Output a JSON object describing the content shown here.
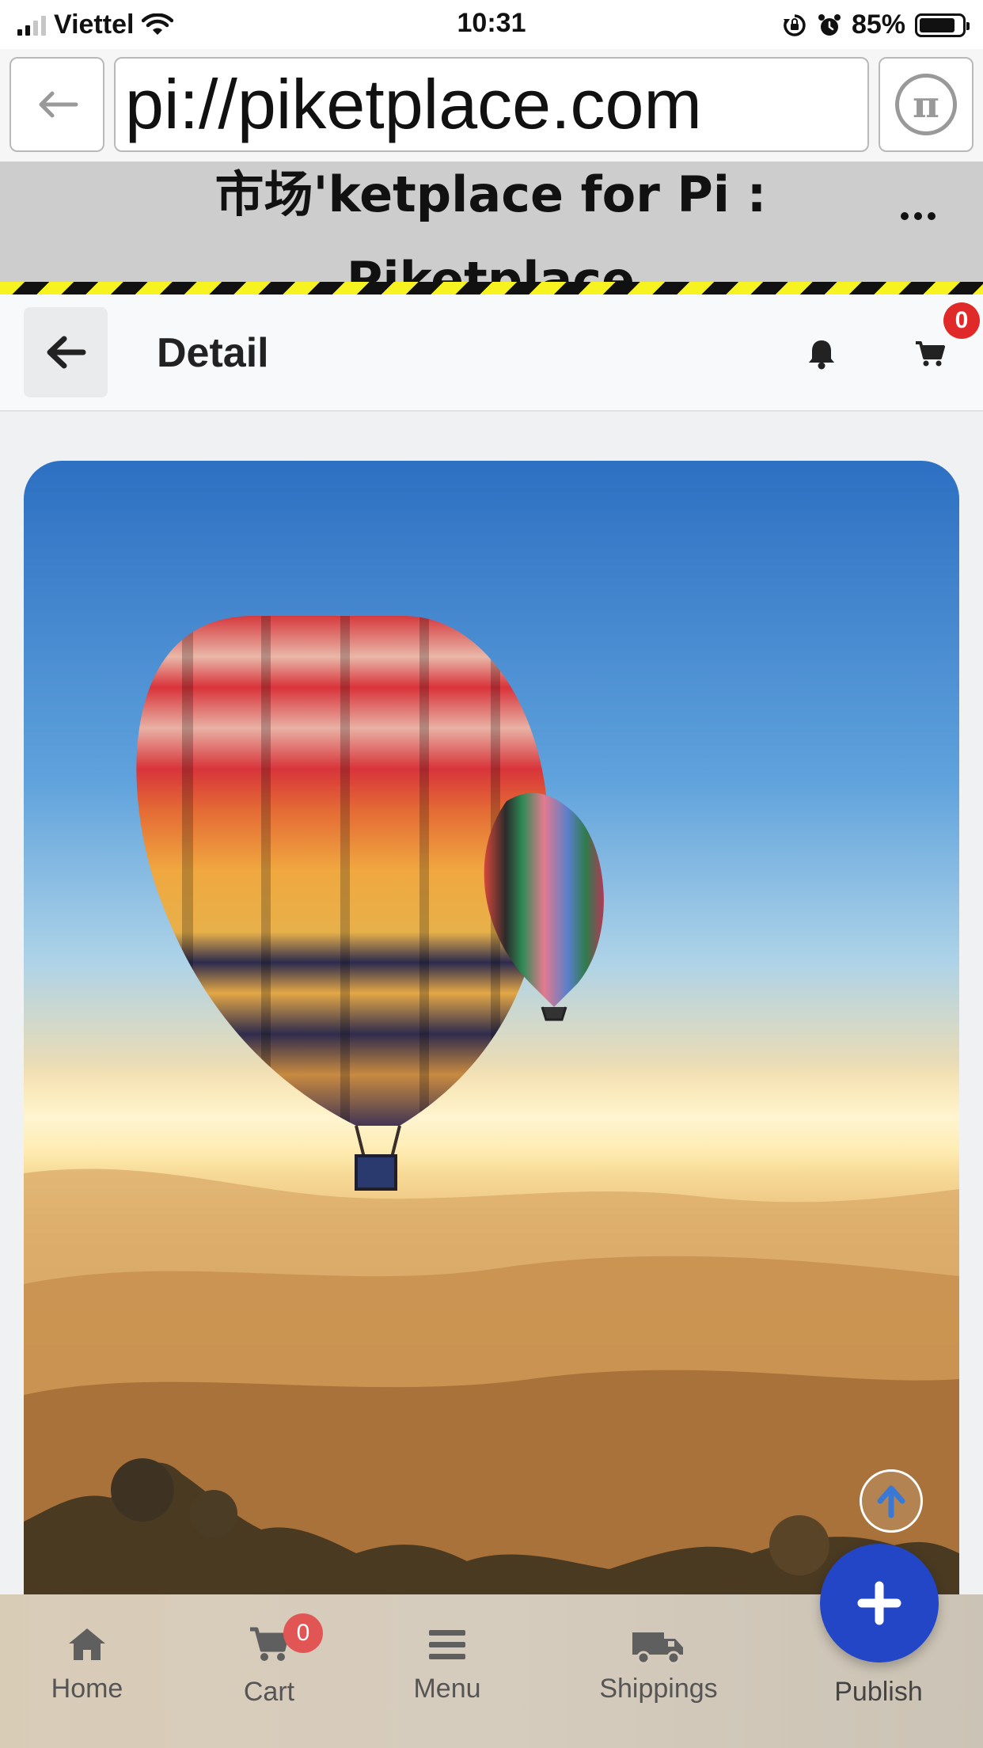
{
  "status_bar": {
    "carrier": "Viettel",
    "time": "10:31",
    "battery": "85%",
    "battery_level": 0.85
  },
  "browser": {
    "url": "pi://piketplace.com",
    "pi_glyph": "π"
  },
  "banner": {
    "title": "市场'ketplace for Pi : Piketplace"
  },
  "header": {
    "title": "Detail",
    "cart_count": "0"
  },
  "nav": {
    "items": [
      {
        "label": "Home",
        "icon": "home-icon"
      },
      {
        "label": "Cart",
        "icon": "cart-icon",
        "badge": "0"
      },
      {
        "label": "Menu",
        "icon": "menu-icon"
      },
      {
        "label": "Shippings",
        "icon": "truck-icon"
      }
    ],
    "publish_label": "Publish"
  },
  "colors": {
    "accent": "#2346c7",
    "badge": "#e02a2a",
    "hazard_yellow": "#f7f320"
  }
}
